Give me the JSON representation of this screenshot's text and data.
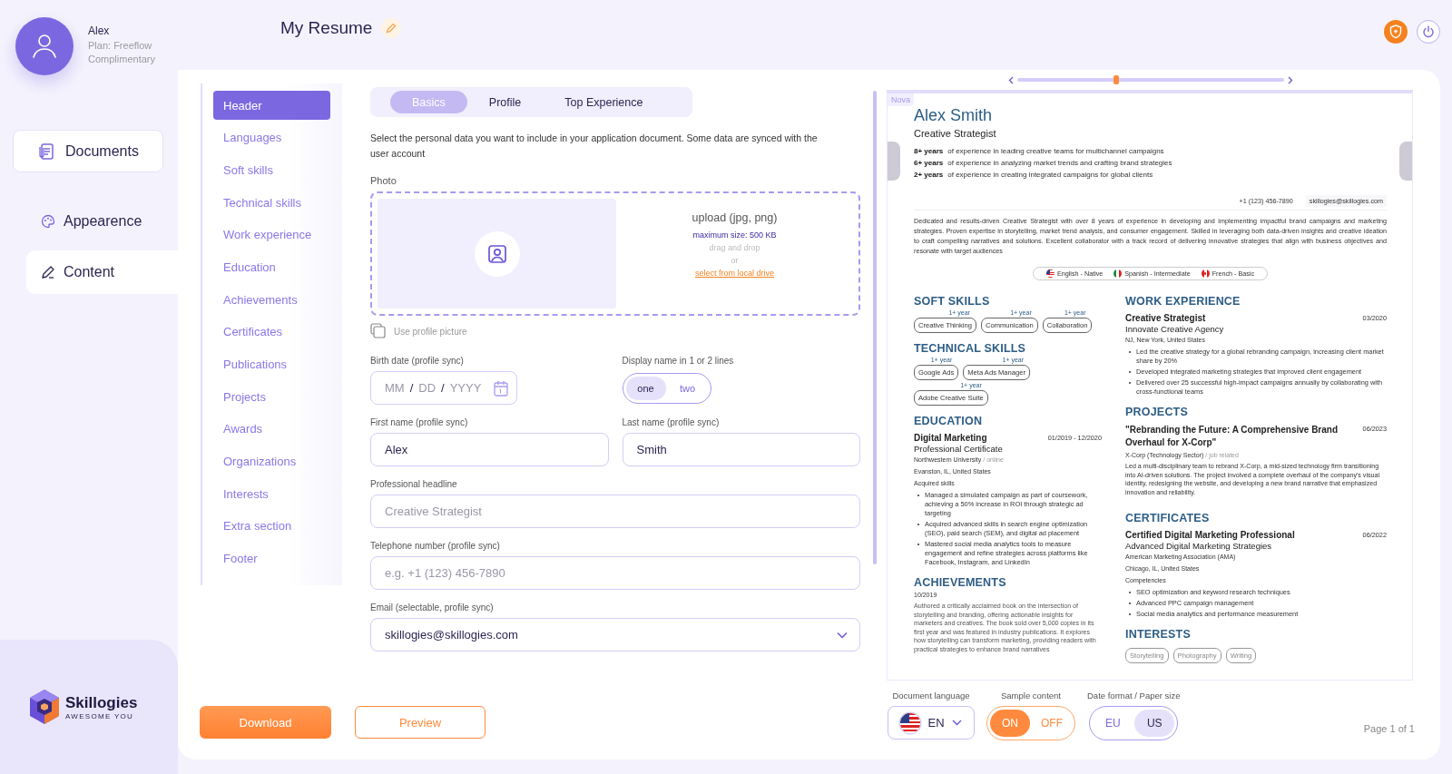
{
  "user": {
    "name": "Alex",
    "plan": "Plan: Freeflow",
    "tier": "Complimentary"
  },
  "documents_button": "Documents",
  "nav": [
    {
      "label": "Appearence",
      "selected": false
    },
    {
      "label": "Content",
      "selected": true
    }
  ],
  "brand": {
    "name": "Skillogies",
    "tagline": "AWESOME YOU"
  },
  "page_title": "My Resume",
  "sections": [
    {
      "label": "Header",
      "selected": true
    },
    {
      "label": "Languages",
      "selected": false
    },
    {
      "label": "Soft skills",
      "selected": false
    },
    {
      "label": "Technical skills",
      "selected": false
    },
    {
      "label": "Work experience",
      "selected": false
    },
    {
      "label": "Education",
      "selected": false
    },
    {
      "label": "Achievements",
      "selected": false
    },
    {
      "label": "Certificates",
      "selected": false
    },
    {
      "label": "Publications",
      "selected": false
    },
    {
      "label": "Projects",
      "selected": false
    },
    {
      "label": "Awards",
      "selected": false
    },
    {
      "label": "Organizations",
      "selected": false
    },
    {
      "label": "Interests",
      "selected": false
    },
    {
      "label": "Extra section",
      "selected": false
    },
    {
      "label": "Footer",
      "selected": false
    }
  ],
  "subtabs": [
    {
      "label": "Basics",
      "selected": true
    },
    {
      "label": "Profile",
      "selected": false
    },
    {
      "label": "Top Experience",
      "selected": false
    }
  ],
  "intro": "Select the personal data you want to include in your application document. Some data are synced with the user account",
  "photo": {
    "label": "Photo",
    "upload": "upload (jpg, png)",
    "max_size": "maximum size: 500 KB",
    "drag": "drag and drop",
    "or": "or",
    "link": "select from local drive"
  },
  "use_profile_picture": {
    "label": "Use profile picture",
    "checked": false
  },
  "birth_date": {
    "label": "Birth date (profile sync)",
    "parts": [
      "MM",
      "/",
      "DD",
      "/",
      "YYYY"
    ]
  },
  "display_name": {
    "label": "Display name in 1 or 2 lines",
    "options": [
      {
        "label": "one",
        "selected": true
      },
      {
        "label": "two",
        "selected": false
      }
    ]
  },
  "name_fields": [
    {
      "label": "First name (profile sync)",
      "value": "Alex"
    },
    {
      "label": "Last name (profile sync)",
      "value": "Smith"
    }
  ],
  "fields": [
    {
      "label": "Professional headline",
      "kind": "text",
      "placeholder": "Creative Strategist"
    },
    {
      "label": "Telephone number (profile sync)",
      "kind": "text",
      "placeholder": "e.g. +1 (123) 456-7890"
    },
    {
      "label": "Email (selectable, profile sync)",
      "kind": "select",
      "value": "skillogies@skillogies.com"
    }
  ],
  "actions": {
    "download": "Download",
    "preview": "Preview"
  },
  "document_language": {
    "label": "Document language",
    "kind": "us",
    "value": "EN"
  },
  "sample_content": {
    "label": "Sample content",
    "options": [
      {
        "label": "ON",
        "selected": true
      },
      {
        "label": "OFF",
        "selected": false
      }
    ]
  },
  "date_format": {
    "label": "Date format / Paper size",
    "options": [
      {
        "label": "EU",
        "selected": false
      },
      {
        "label": "US",
        "selected": true
      }
    ]
  },
  "page_indicator": "Page 1 of 1",
  "preview": {
    "zoom": {
      "level": 0.37
    },
    "template": "Nova",
    "resume": {
      "name": "Alex Smith",
      "headline": "Creative Strategist",
      "highlights": [
        {
          "years": "8+ years",
          "text": "of experience in leading creative teams for multichannel campaigns"
        },
        {
          "years": "6+ years",
          "text": "of experience in analyzing market trends and crafting brand strategies"
        },
        {
          "years": "2+ years",
          "text": "of experience in creating integrated campaigns for global clients"
        }
      ],
      "phone": "+1 (123) 456-7890",
      "email": "skillogies@skillogies.com",
      "summary": "Dedicated and results-driven Creative Strategist with over 8 years of experience in developing and implementing impactful brand campaigns and marketing strategies. Proven expertise in storytelling, market trend analysis, and consumer engagement. Skilled in leveraging both data-driven insights and creative ideation to craft compelling narratives and solutions. Excellent collaborator with a track record of delivering innovative strategies that align with business objectives and resonate with target audiences",
      "languages": [
        {
          "label": "English - Native",
          "kind": "us"
        },
        {
          "label": "Spanish - Intermediate",
          "kind": "mx"
        },
        {
          "label": "French - Basic",
          "kind": "ca"
        }
      ],
      "soft_skills": {
        "title": "SOFT SKILLS",
        "items": [
          {
            "name": "Creative Thinking",
            "years": "1+ year"
          },
          {
            "name": "Communication",
            "years": "1+ year"
          },
          {
            "name": "Collaboration",
            "years": "1+ year"
          }
        ]
      },
      "technical_skills": {
        "title": "TECHNICAL SKILLS",
        "items": [
          {
            "name": "Google Ads",
            "years": "1+ year"
          },
          {
            "name": "Meta Ads Manager",
            "years": "1+ year"
          },
          {
            "name": "Adobe Creative Suite",
            "years": "1+ year"
          }
        ]
      },
      "education": {
        "title": "EDUCATION",
        "degree": "Digital Marketing",
        "date": "01/2019 - 12/2020",
        "subtitle": "Professional Certificate",
        "school": "Northwestern University",
        "mode": "/ online",
        "location": "Evanston, IL, United States",
        "skills_label": "Acquired skills",
        "bullets": [
          "Managed a simulated campaign as part of coursework, achieving a 50% increase in ROI through strategic ad targeting",
          "Acquired advanced skills in search engine optimization (SEO), paid search (SEM), and digital ad placement",
          "Mastered social media analytics tools to measure engagement and refine strategies across platforms like Facebook, Instagram, and LinkedIn"
        ]
      },
      "achievements": {
        "title": "ACHIEVEMENTS",
        "date": "10/2019",
        "text": "Authored a critically acclaimed book on the intersection of storytelling and branding, offering actionable insights for marketers and creatives. The book sold over 5,000 copies in its first year and was featured in industry publications. It explores how storytelling can transform marketing, providing readers with practical strategies to enhance brand narratives"
      },
      "work_experience": {
        "title": "WORK EXPERIENCE",
        "role": "Creative Strategist",
        "date": "03/2020",
        "company": "Innovate Creative Agency",
        "location": "NJ, New York, United States",
        "bullets": [
          "Led the creative strategy for a global rebranding campaign, increasing client market share by 20%",
          "Developed integrated marketing strategies that improved client engagement",
          "Delivered over 25 successful high-impact campaigns annually by collaborating with cross-functional teams"
        ]
      },
      "projects": {
        "title": "PROJECTS",
        "name": "\"Rebranding the Future: A Comprehensive Brand Overhaul for X-Corp\"",
        "date": "06/2023",
        "org": "X-Corp (Technology Sector)",
        "relation": "/ job related",
        "text": "Led a multi-disciplinary team to rebrand X-Corp, a mid-sized technology firm transitioning into AI-driven solutions. The project involved a complete overhaul of the company's visual identity, redesigning the website, and developing a new brand narrative that emphasized innovation and reliability."
      },
      "certificates": {
        "title": "CERTIFICATES",
        "name": "Certified Digital Marketing Professional",
        "date": "06/2022",
        "subtitle": "Advanced Digital Marketing Strategies",
        "org": "American Marketing Association (AMA)",
        "location": "Chicago, IL, United States",
        "label": "Competencies",
        "bullets": [
          "SEO optimization and keyword research techniques",
          "Advanced PPC campaign management",
          "Social media analytics and performance measurement"
        ]
      },
      "interests": {
        "title": "INTERESTS",
        "items": [
          "Storytelling",
          "Photography",
          "Writing"
        ]
      }
    }
  }
}
